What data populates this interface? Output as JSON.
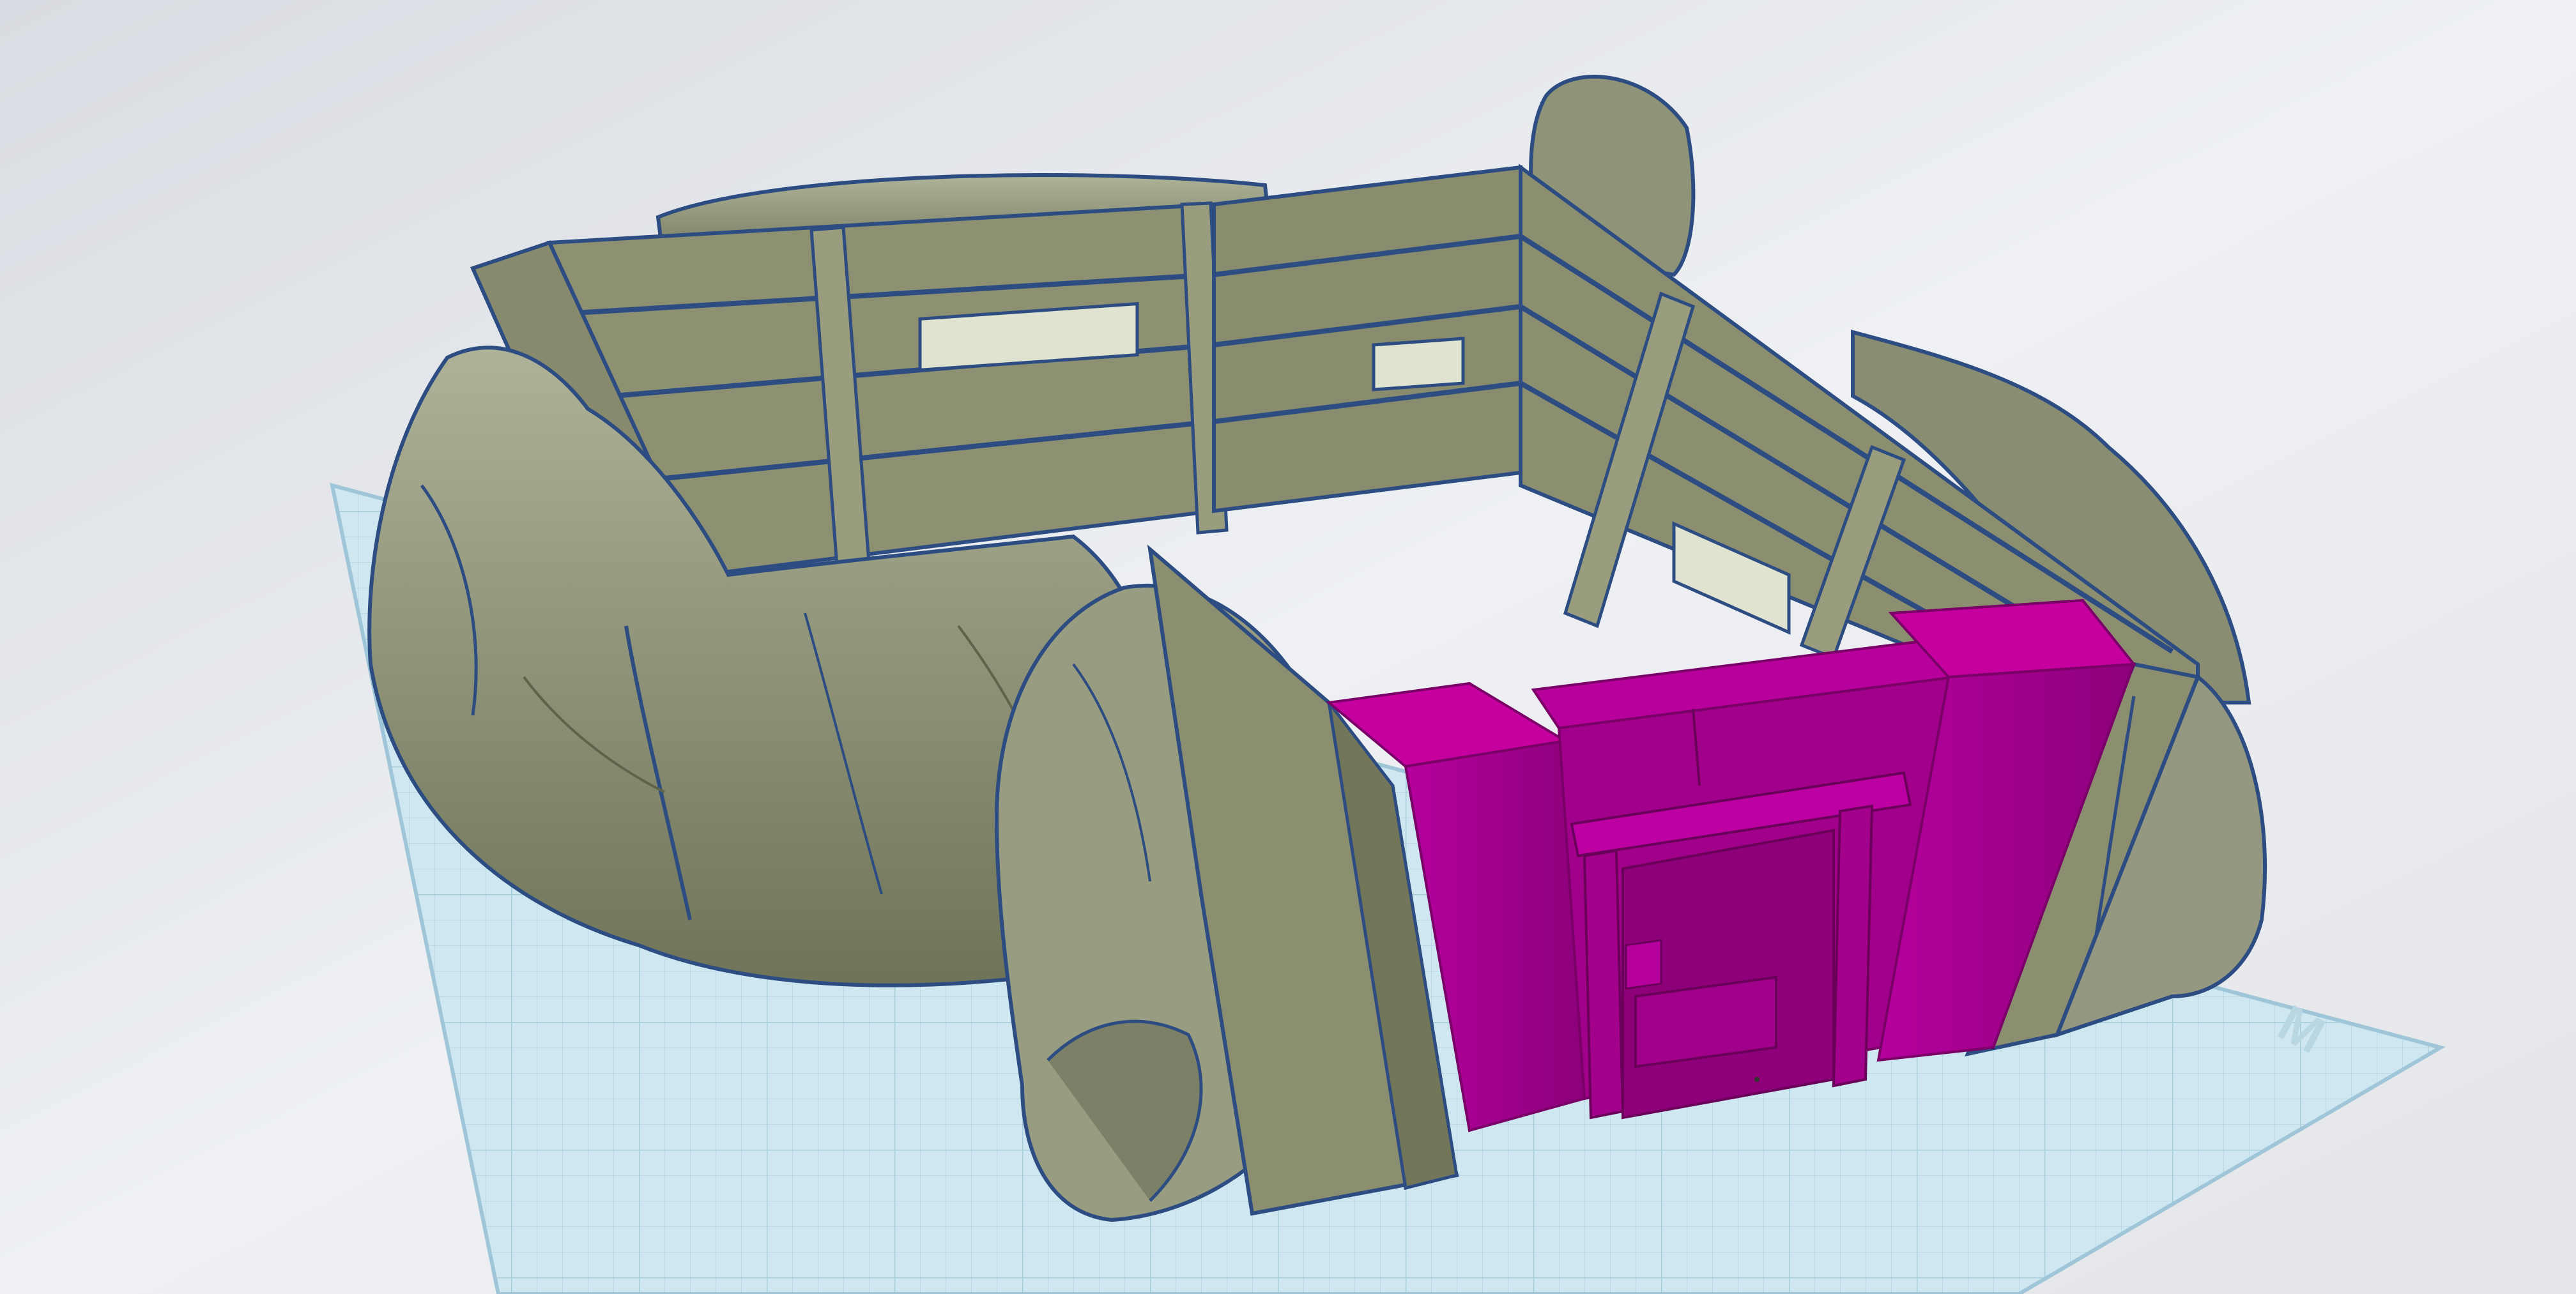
{
  "app": {
    "view": "3d-workplane",
    "grid_label": "",
    "axis_marker": "M"
  },
  "scene": {
    "object": "bunker-diorama",
    "components": [
      "rock-formations",
      "plank-walls",
      "support-posts",
      "wall-windows",
      "selected-gate"
    ]
  },
  "colors": {
    "background": "#e6e8ec",
    "workplane": "#cde6f0",
    "grid_line": "#b7d6e4",
    "rock": "#8f9378",
    "rock_shadow": "#6f7358",
    "rock_highlight": "#b3b79c",
    "wall": "#8e9072",
    "wall_dark": "#76785c",
    "outline": "#2d4d82",
    "selection": "#b1009a",
    "selection_dark": "#8a0078"
  }
}
